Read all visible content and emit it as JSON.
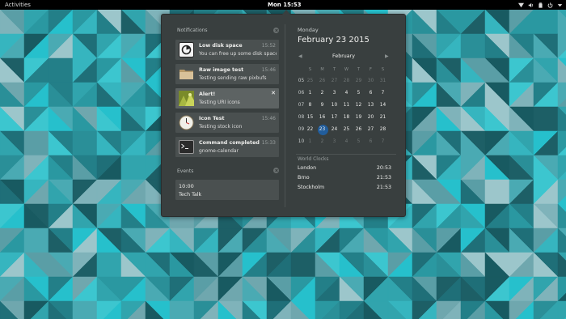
{
  "topbar": {
    "activities": "Activities",
    "clock": "Mon 15:53",
    "icons": [
      "network-icon",
      "volume-icon",
      "battery-icon",
      "power-icon",
      "dropdown-arrow-icon"
    ]
  },
  "notifications": {
    "header": "Notifications",
    "items": [
      {
        "title": "Low disk space",
        "body": "You can free up some disk space...",
        "time": "15:52",
        "icon": "disk-icon",
        "highlighted": false
      },
      {
        "title": "Raw image test",
        "body": "Testing sending raw pixbufs",
        "time": "15:46",
        "icon": "folder-icon",
        "highlighted": false
      },
      {
        "title": "Alert!",
        "body": "Testing URI icons",
        "time": "",
        "icon": "image-thumbnail-icon",
        "highlighted": true
      },
      {
        "title": "Icon Test",
        "body": "Testing stock icon",
        "time": "15:46",
        "icon": "clock-icon",
        "highlighted": false
      },
      {
        "title": "Command completed",
        "body": "gnome-calendar",
        "time": "15:33",
        "icon": "terminal-icon",
        "highlighted": false
      }
    ]
  },
  "events": {
    "header": "Events",
    "items": [
      {
        "time": "10:00",
        "title": "Tech Talk"
      }
    ]
  },
  "calendar": {
    "weekday": "Monday",
    "date": "February 23 2015",
    "prev": "◀",
    "next": "▶",
    "month": "February",
    "dow": [
      "S",
      "M",
      "T",
      "W",
      "T",
      "F",
      "S"
    ],
    "weeks": [
      {
        "num": "05",
        "days": [
          {
            "d": "25",
            "o": true
          },
          {
            "d": "26",
            "o": true
          },
          {
            "d": "27",
            "o": true
          },
          {
            "d": "28",
            "o": true
          },
          {
            "d": "29",
            "o": true
          },
          {
            "d": "30",
            "o": true
          },
          {
            "d": "31",
            "o": true
          }
        ]
      },
      {
        "num": "06",
        "days": [
          {
            "d": "1"
          },
          {
            "d": "2"
          },
          {
            "d": "3"
          },
          {
            "d": "4"
          },
          {
            "d": "5"
          },
          {
            "d": "6"
          },
          {
            "d": "7"
          }
        ]
      },
      {
        "num": "07",
        "days": [
          {
            "d": "8"
          },
          {
            "d": "9"
          },
          {
            "d": "10"
          },
          {
            "d": "11"
          },
          {
            "d": "12"
          },
          {
            "d": "13"
          },
          {
            "d": "14"
          }
        ]
      },
      {
        "num": "08",
        "days": [
          {
            "d": "15"
          },
          {
            "d": "16"
          },
          {
            "d": "17"
          },
          {
            "d": "18"
          },
          {
            "d": "19"
          },
          {
            "d": "20"
          },
          {
            "d": "21"
          }
        ]
      },
      {
        "num": "09",
        "days": [
          {
            "d": "22"
          },
          {
            "d": "23",
            "today": true
          },
          {
            "d": "24"
          },
          {
            "d": "25"
          },
          {
            "d": "26"
          },
          {
            "d": "27"
          },
          {
            "d": "28"
          }
        ]
      },
      {
        "num": "10",
        "days": [
          {
            "d": "1",
            "o": true
          },
          {
            "d": "2",
            "o": true
          },
          {
            "d": "3",
            "o": true
          },
          {
            "d": "4",
            "o": true
          },
          {
            "d": "5",
            "o": true
          },
          {
            "d": "6",
            "o": true
          },
          {
            "d": "7",
            "o": true
          }
        ]
      }
    ]
  },
  "world_clocks": {
    "header": "World Clocks",
    "items": [
      {
        "city": "London",
        "time": "20:53"
      },
      {
        "city": "Brno",
        "time": "21:53"
      },
      {
        "city": "Stockholm",
        "time": "21:53"
      }
    ]
  },
  "colors": {
    "topbar": "#000000",
    "popup": "#393f3f",
    "today_highlight": "#215d9c",
    "wallpaper_accent": "#2fc5d0"
  }
}
